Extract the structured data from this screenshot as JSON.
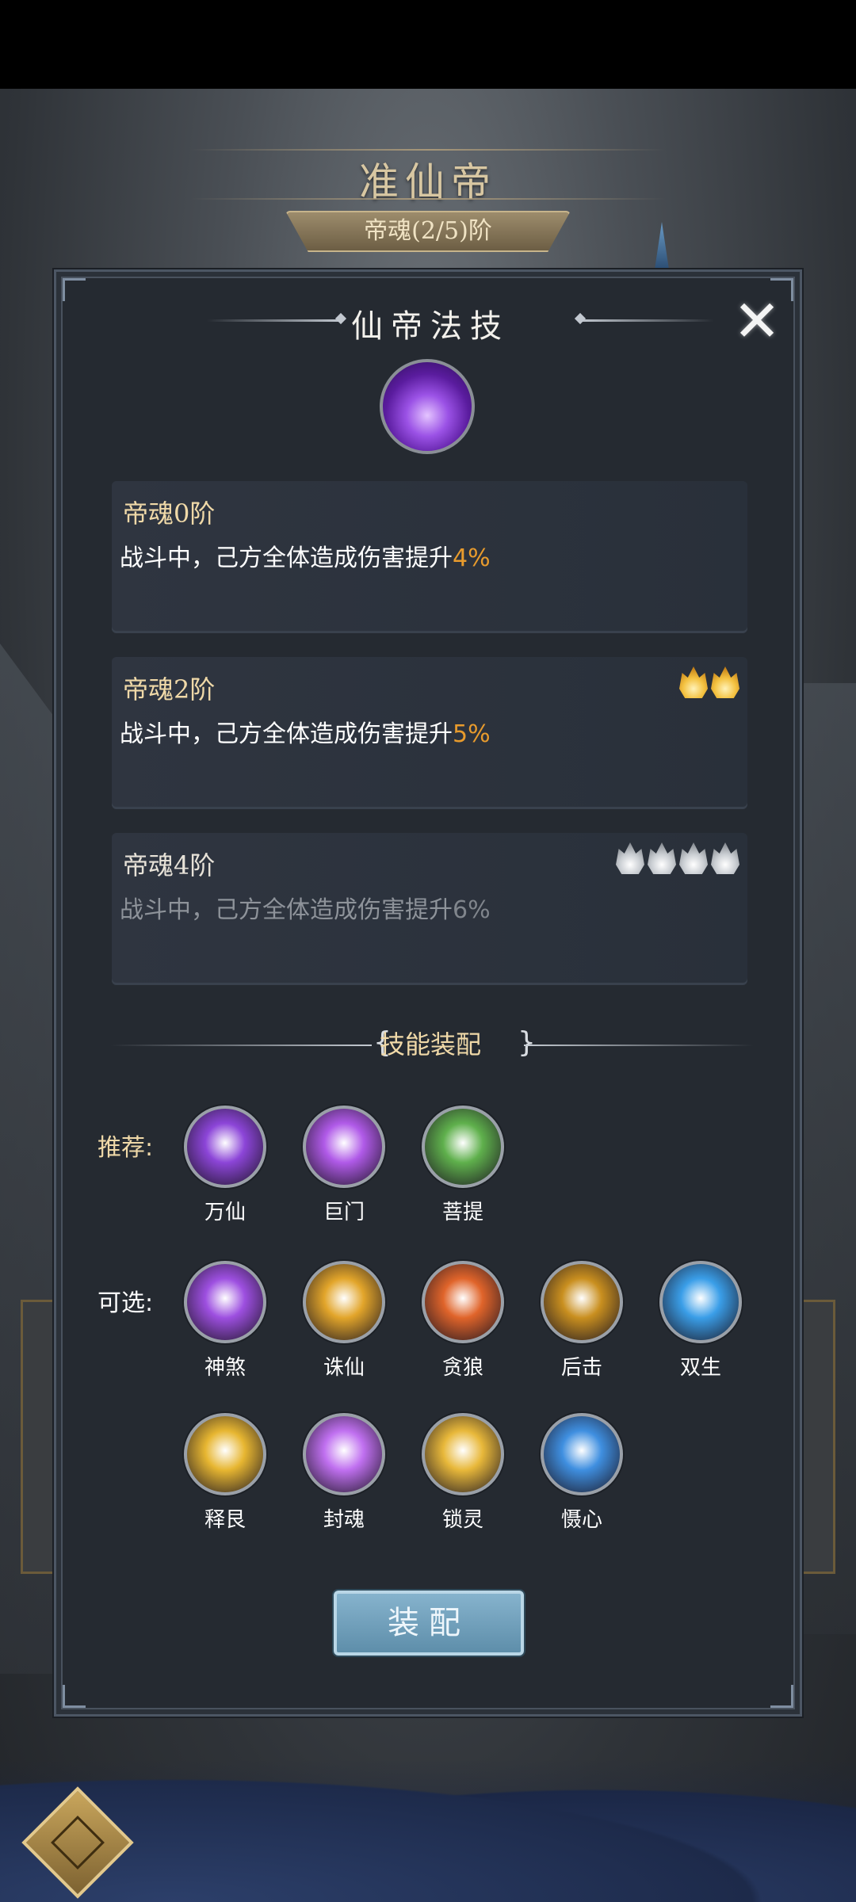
{
  "header": {
    "rank_title": "准仙帝",
    "rank_progress": "帝魂(2/5)阶"
  },
  "modal": {
    "title": "仙帝法技",
    "close_label": "✕",
    "tiers": [
      {
        "title": "帝魂0阶",
        "desc": "战斗中，己方全体造成伤害提升",
        "pct": "4%",
        "flames": 0,
        "active": true
      },
      {
        "title": "帝魂2阶",
        "desc": "战斗中，己方全体造成伤害提升",
        "pct": "5%",
        "flames": 2,
        "flame_color": "gold",
        "active": true
      },
      {
        "title": "帝魂4阶",
        "desc": "战斗中，己方全体造成伤害提升",
        "pct": "6%",
        "flames": 4,
        "flame_color": "grey",
        "active": false
      }
    ],
    "section_title": "技能装配",
    "recommended_label": "推荐:",
    "optional_label": "可选:",
    "recommended": [
      {
        "name": "万仙",
        "icon": "purple-check-icon",
        "color": "#8c45d8"
      },
      {
        "name": "巨门",
        "icon": "purple-portal-icon",
        "color": "#b05ae8"
      },
      {
        "name": "菩提",
        "icon": "green-light-icon",
        "color": "#5fb04c"
      }
    ],
    "optional": [
      {
        "name": "神煞",
        "icon": "purple-claw-icon",
        "color": "#9d4fe0"
      },
      {
        "name": "诛仙",
        "icon": "gold-slash-icon",
        "color": "#e2a52a"
      },
      {
        "name": "贪狼",
        "icon": "fire-claw-icon",
        "color": "#e0642a"
      },
      {
        "name": "后击",
        "icon": "gold-strike-icon",
        "color": "#c98f1f"
      },
      {
        "name": "双生",
        "icon": "blue-swirl-icon",
        "color": "#3a9ee8"
      },
      {
        "name": "释艮",
        "icon": "gold-shield-icon",
        "color": "#e7b631"
      },
      {
        "name": "封魂",
        "icon": "purple-seal-icon",
        "color": "#c070f0"
      },
      {
        "name": "锁灵",
        "icon": "gold-pillar-icon",
        "color": "#e8b83a"
      },
      {
        "name": "慑心",
        "icon": "blue-lotus-icon",
        "color": "#3f8fe0"
      }
    ],
    "equip_label": "装配"
  }
}
